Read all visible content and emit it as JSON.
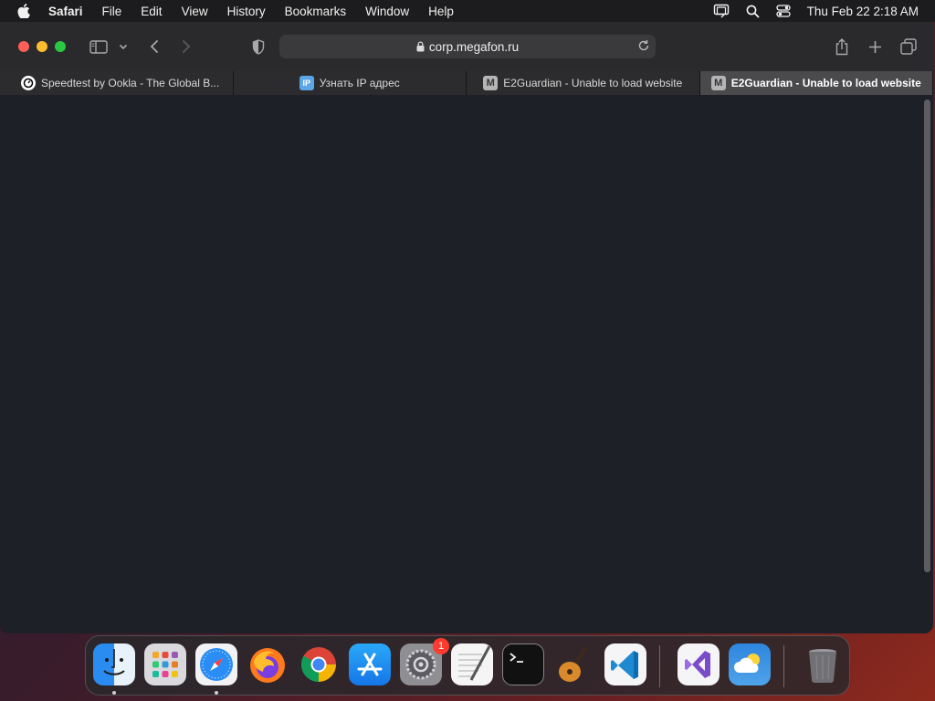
{
  "menubar": {
    "app_name": "Safari",
    "items": [
      "File",
      "Edit",
      "View",
      "History",
      "Bookmarks",
      "Window",
      "Help"
    ],
    "clock": "Thu Feb 22  2:18 AM"
  },
  "toolbar": {
    "address": "corp.megafon.ru"
  },
  "tabs": [
    {
      "title": "Speedtest by Ookla - The Global B...",
      "favicon": "speedtest-icon",
      "active": false
    },
    {
      "title": "Узнать IP адрес",
      "favicon": "ip-icon",
      "favicon_text": "IP",
      "active": false
    },
    {
      "title": "E2Guardian - Unable to load website",
      "favicon": "m-icon",
      "favicon_text": "M",
      "active": false
    },
    {
      "title": "E2Guardian - Unable to load website",
      "favicon": "m-icon",
      "favicon_text": "M",
      "active": true
    }
  ],
  "dock": {
    "apps": [
      "Finder",
      "Launchpad",
      "Safari",
      "Firefox",
      "Chrome",
      "App Store",
      "System Settings",
      "TextEdit",
      "Terminal",
      "GarageBand",
      "Visual Studio Code",
      "Visual Studio",
      "Weather",
      "Trash"
    ],
    "settings_badge": "1"
  },
  "colors": {
    "content_bg": "#1e2028",
    "close": "#ff5f57",
    "minimize": "#febc2e",
    "zoom": "#28c840"
  }
}
